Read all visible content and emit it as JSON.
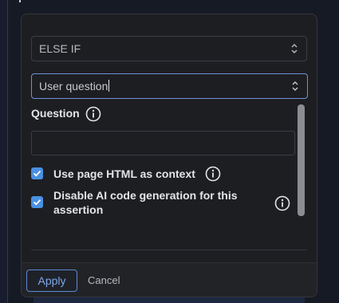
{
  "condition_select": {
    "value": "ELSE IF"
  },
  "type_select": {
    "value": "User question"
  },
  "question": {
    "label": "Question",
    "value": ""
  },
  "options": [
    {
      "label": "Use page HTML as context",
      "checked": true
    },
    {
      "label": "Disable AI code generation for this assertion",
      "checked": true
    }
  ],
  "footer": {
    "apply_label": "Apply",
    "cancel_label": "Cancel"
  },
  "colors": {
    "accent": "#4a90e2",
    "panel": "#1d1e22",
    "focus_border": "#6d93d6"
  },
  "icons": [
    "chevron-updown-icon",
    "info-icon",
    "checkmark-icon"
  ]
}
